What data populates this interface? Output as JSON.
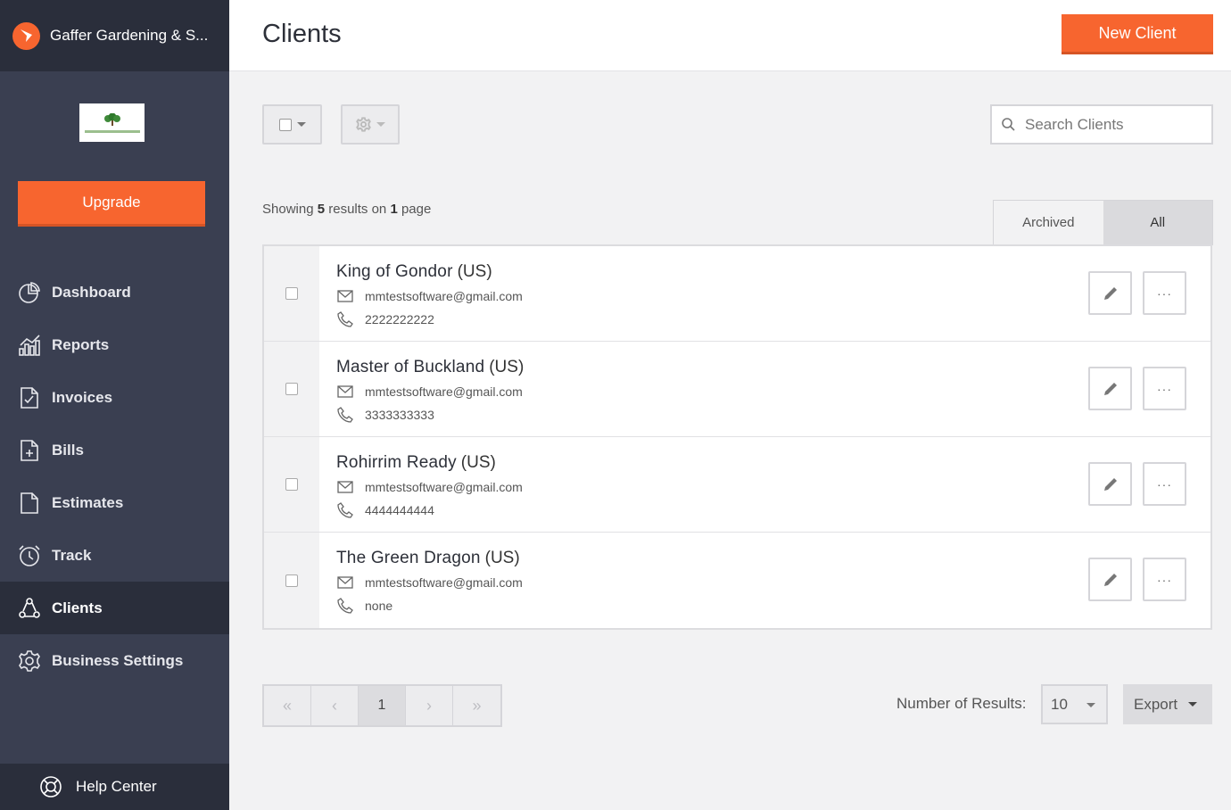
{
  "sidebar": {
    "business_name": "Gaffer Gardening & S...",
    "upgrade_label": "Upgrade",
    "nav": [
      {
        "label": "Dashboard",
        "icon": "dashboard-icon"
      },
      {
        "label": "Reports",
        "icon": "reports-icon"
      },
      {
        "label": "Invoices",
        "icon": "invoices-icon"
      },
      {
        "label": "Bills",
        "icon": "bills-icon"
      },
      {
        "label": "Estimates",
        "icon": "estimates-icon"
      },
      {
        "label": "Track",
        "icon": "track-icon"
      },
      {
        "label": "Clients",
        "icon": "clients-icon",
        "active": true
      },
      {
        "label": "Business Settings",
        "icon": "gear-icon"
      }
    ],
    "help_label": "Help Center"
  },
  "header": {
    "title": "Clients",
    "new_client_label": "New Client"
  },
  "toolbar": {
    "search_placeholder": "Search Clients"
  },
  "results": {
    "prefix": "Showing ",
    "count": "5",
    "middle": " results on ",
    "pages": "1",
    "suffix": " page"
  },
  "tabs": [
    {
      "label": "Archived",
      "active": false
    },
    {
      "label": "All",
      "active": true
    }
  ],
  "clients": [
    {
      "name": "King of Gondor",
      "region": "(US)",
      "email": "mmtestsoftware@gmail.com",
      "phone": "2222222222"
    },
    {
      "name": "Master of Buckland",
      "region": "(US)",
      "email": "mmtestsoftware@gmail.com",
      "phone": "3333333333"
    },
    {
      "name": "Rohirrim Ready",
      "region": "(US)",
      "email": "mmtestsoftware@gmail.com",
      "phone": "4444444444"
    },
    {
      "name": "The Green Dragon",
      "region": "(US)",
      "email": "mmtestsoftware@gmail.com",
      "phone": "none"
    }
  ],
  "pagination": {
    "current_page": "1",
    "number_of_results_label": "Number of Results:",
    "number_of_results_value": "10",
    "export_label": "Export"
  },
  "colors": {
    "accent": "#f7652f",
    "sidebar": "#3a3f51",
    "sidebar_dark": "#2a2e3b"
  }
}
